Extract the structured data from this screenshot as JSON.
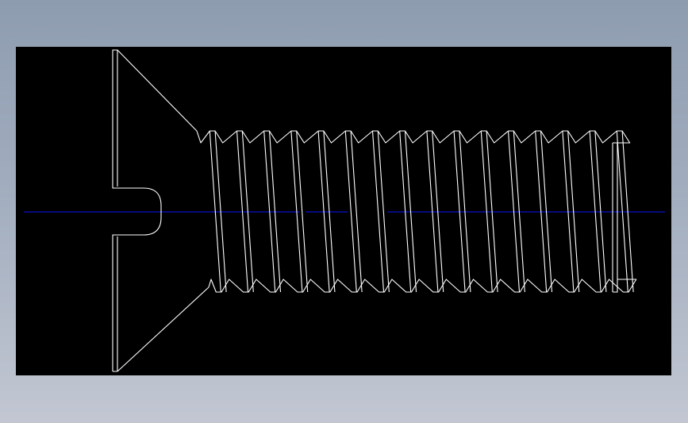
{
  "drawing": {
    "subject": "countersunk-slotted-screw",
    "view": "side",
    "thread_crest_count": 16,
    "colors": {
      "background": "#000000",
      "outline": "#ffffff",
      "centerline": "#0a10c8",
      "surround": "#98a4b6"
    }
  }
}
